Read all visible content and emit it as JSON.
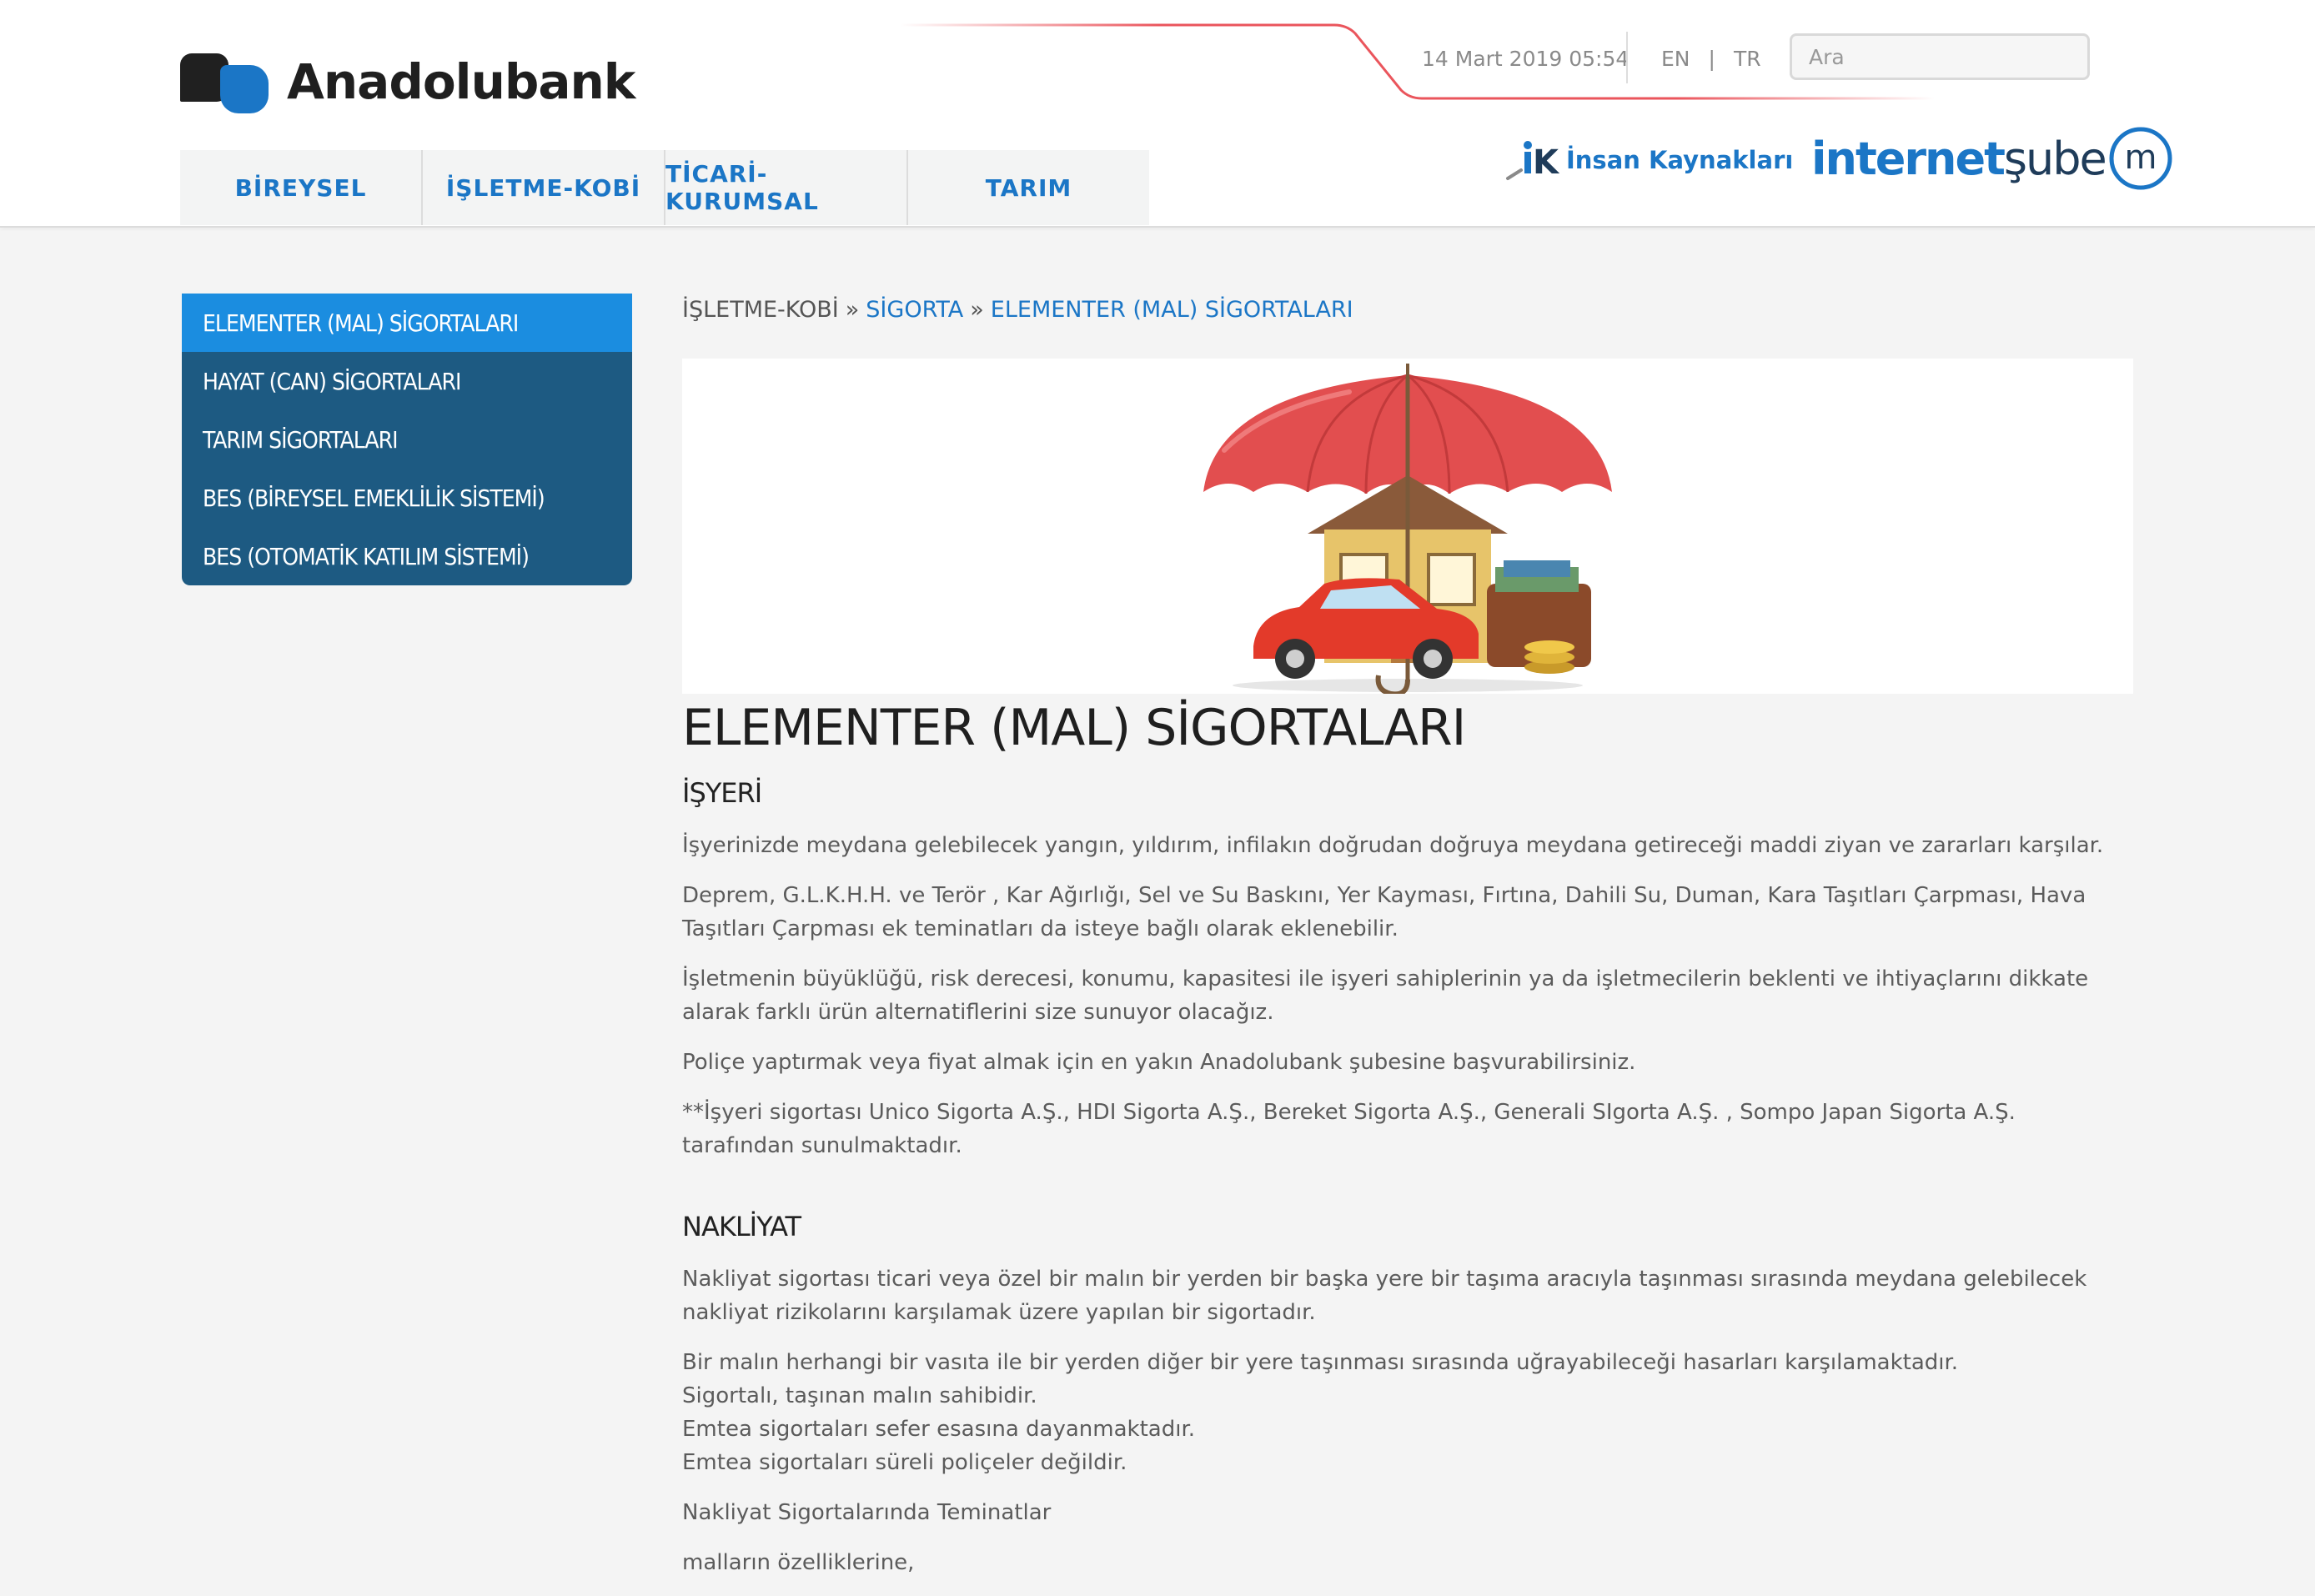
{
  "header": {
    "logo_text": "Anadolubank",
    "date": "14 Mart 2019 05:54",
    "lang_en": "EN",
    "lang_sep": "|",
    "lang_tr": "TR",
    "search_placeholder": "Ara",
    "ik_label": "İnsan Kaynakları",
    "internetsube_part1": "internet",
    "internetsube_part2": "şube"
  },
  "nav": {
    "items": [
      "BİREYSEL",
      "İŞLETME-KOBİ",
      "TİCARİ-KURUMSAL",
      "TARIM"
    ]
  },
  "sidebar": {
    "items": [
      {
        "label": "ELEMENTER (MAL) SİGORTALARI",
        "active": true
      },
      {
        "label": "HAYAT (CAN) SİGORTALARI"
      },
      {
        "label": "TARIM SİGORTALARI"
      },
      {
        "label": "BES (BİREYSEL EMEKLİLİK SİSTEMİ)"
      },
      {
        "label": "BES (OTOMATİK KATILIM SİSTEMİ)"
      }
    ]
  },
  "breadcrumb": {
    "item1": "İŞLETME-KOBİ",
    "sep": "»",
    "item2": "SİGORTA",
    "item3": "ELEMENTER (MAL) SİGORTALARI"
  },
  "main": {
    "title": "ELEMENTER (MAL) SİGORTALARI",
    "section1_heading": "İŞYERİ",
    "section1_paragraphs": [
      "İşyerinizde meydana gelebilecek yangın, yıldırım, infilakın doğrudan doğruya meydana getireceği maddi ziyan ve zararları karşılar.",
      "Deprem, G.L.K.H.H. ve Terör , Kar Ağırlığı, Sel ve Su Baskını, Yer Kayması, Fırtına, Dahili Su, Duman, Kara Taşıtları Çarpması, Hava Taşıtları Çarpması ek teminatları da isteye bağlı olarak eklenebilir.",
      "İşletmenin büyüklüğü, risk derecesi, konumu, kapasitesi ile işyeri sahiplerinin ya da işletmecilerin beklenti ve ihtiyaçlarını dikkate alarak farklı ürün alternatiflerini size sunuyor olacağız.",
      "Poliçe yaptırmak veya fiyat almak için en yakın Anadolubank şubesine başvurabilirsiniz.",
      "**İşyeri sigortası Unico Sigorta A.Ş., HDI Sigorta A.Ş., Bereket Sigorta A.Ş., Generali SIgorta A.Ş. , Sompo Japan Sigorta A.Ş. tarafından sunulmaktadır."
    ],
    "section2_heading": "NAKLİYAT",
    "section2_p1": "Nakliyat sigortası ticari veya özel bir malın bir yerden bir başka yere bir taşıma aracıyla taşınması sırasında meydana gelebilecek nakliyat rizikolarını karşılamak üzere yapılan bir sigortadır.",
    "section2_lines": [
      "Bir malın herhangi bir vasıta ile bir yerden diğer bir yere taşınması sırasında uğrayabileceği hasarları karşılamaktadır.",
      "Sigortalı, taşınan malın sahibidir.",
      "Emtea sigortaları sefer esasına dayanmaktadır.",
      "Emtea sigortaları süreli poliçeler değildir."
    ],
    "section2_p3": "Nakliyat Sigortalarında Teminatlar",
    "section2_p4": "malların özelliklerine,"
  },
  "colors": {
    "brand_blue": "#1b76c6",
    "sidebar_bg": "#1d5a82",
    "sidebar_active": "#1b8de0",
    "accent_red": "#e8424a"
  }
}
